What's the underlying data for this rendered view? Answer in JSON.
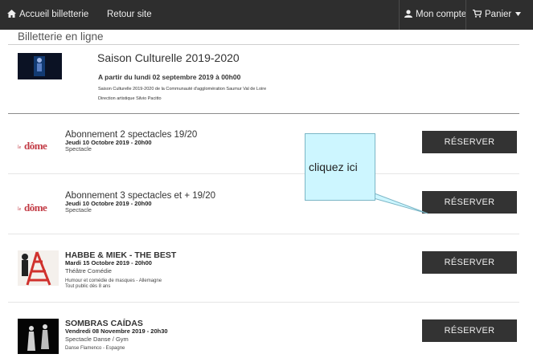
{
  "navbar": {
    "home_label": "Accueil billetterie",
    "back_label": "Retour site",
    "account_label": "Mon compte",
    "cart_label": "Panier"
  },
  "page": {
    "title": "Billetterie en ligne"
  },
  "season": {
    "title": "Saison Culturelle 2019-2020",
    "date": "A partir du lundi 02 septembre 2019 à 00h00",
    "line1": "Saison Culturelle 2019-2020 de la Communauté d'agglomération Saumur Val de Loire",
    "line2": "Direction artistique Silvio Pacitto"
  },
  "events": [
    {
      "title": "Abonnement 2 spectacles 19/20",
      "date": "Jeudi 10 Octobre 2019 - 20h00",
      "category": "Spectacle",
      "button": "RÉSERVER"
    },
    {
      "title": "Abonnement 3 spectacles et + 19/20",
      "date": "Jeudi 10 Octobre 2019 - 20h00",
      "category": "Spectacle",
      "button": "RÉSERVER"
    },
    {
      "title": "HABBE & MIEK - THE BEST",
      "date": "Mardi 15 Octobre 2019 - 20h00",
      "category": "Théâtre   Comédie",
      "sub1": "Humour et comédie de masques - Allemagne",
      "sub2": "Tout public dès 8 ans",
      "button": "RÉSERVER"
    },
    {
      "title": "SOMBRAS CAÍDAS",
      "date": "Vendredi 08 Novembre 2019 - 20h30",
      "category": "Spectacle   Danse / Gym",
      "sub1": "Danse Flamenco - Espagne",
      "button": "RÉSERVER"
    }
  ],
  "callout": {
    "text": "cliquez ici"
  },
  "logo": {
    "text": "le dôme"
  }
}
